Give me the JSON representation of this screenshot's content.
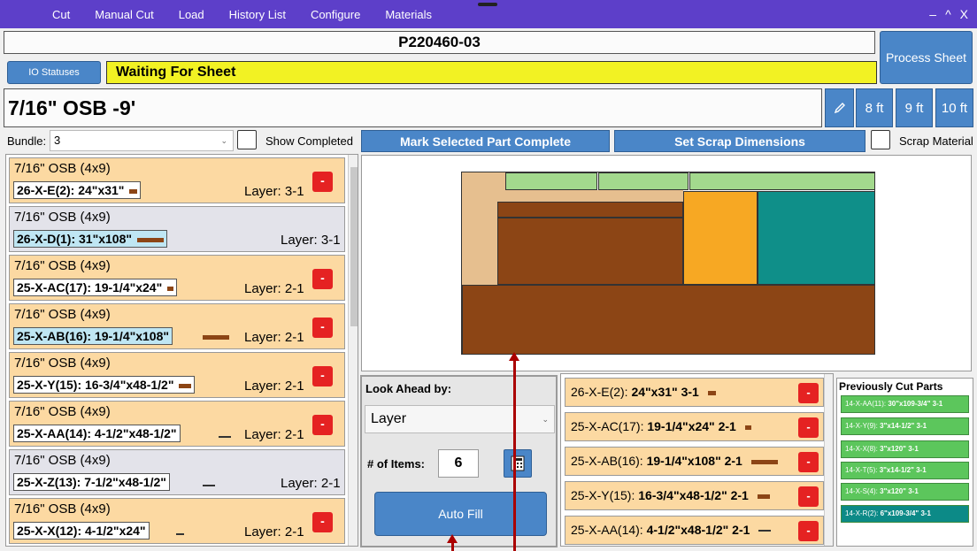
{
  "menu": {
    "items": [
      "Cut",
      "Manual Cut",
      "Load",
      "History List",
      "Configure",
      "Materials"
    ],
    "window": [
      "–",
      "^",
      "X"
    ]
  },
  "job": {
    "number": "P220460-03"
  },
  "process_sheet_label": "Process Sheet",
  "io_statuses_label": "IO Statuses",
  "status_text": "Waiting For Sheet",
  "material_name": "7/16\" OSB -9'",
  "sizes": [
    "8 ft",
    "9 ft",
    "10 ft"
  ],
  "bundle": {
    "label": "Bundle:",
    "value": "3"
  },
  "show_completed_label": "Show Completed",
  "mark_complete_label": "Mark Selected Part Complete",
  "set_scrap_label": "Set Scrap Dimensions",
  "scrap_material_label": "Scrap Material",
  "parts": [
    {
      "material": "7/16\" OSB  (4x9)",
      "part": "26-X-E(2): 24\"x31\"",
      "layer": "Layer: 3-1",
      "style": "orange",
      "remove": "-",
      "selected": false
    },
    {
      "material": "7/16\" OSB  (4x9)",
      "part": "26-X-D(1): 31\"x108\"",
      "layer": "Layer: 3-1",
      "style": "gray",
      "remove": "",
      "selected": true
    },
    {
      "material": "7/16\" OSB  (4x9)",
      "part": "25-X-AC(17): 19-1/4\"x24\"",
      "layer": "Layer: 2-1",
      "style": "orange",
      "remove": "-",
      "selected": false
    },
    {
      "material": "7/16\" OSB  (4x9)",
      "part": "25-X-AB(16): 19-1/4\"x108\"",
      "layer": "Layer: 2-1",
      "style": "orange",
      "remove": "-",
      "selected": true
    },
    {
      "material": "7/16\" OSB  (4x9)",
      "part": "25-X-Y(15): 16-3/4\"x48-1/2\"",
      "layer": "Layer: 2-1",
      "style": "orange",
      "remove": "-",
      "selected": false
    },
    {
      "material": "7/16\" OSB  (4x9)",
      "part": "25-X-AA(14): 4-1/2\"x48-1/2\"",
      "layer": "Layer: 2-1",
      "style": "orange",
      "remove": "-",
      "selected": false
    },
    {
      "material": "7/16\" OSB  (4x9)",
      "part": "25-X-Z(13): 7-1/2\"x48-1/2\"",
      "layer": "Layer: 2-1",
      "style": "gray",
      "remove": "",
      "selected": false
    },
    {
      "material": "7/16\" OSB  (4x9)",
      "part": "25-X-X(12): 4-1/2\"x24\"",
      "layer": "Layer: 2-1",
      "style": "orange",
      "remove": "-",
      "selected": false
    }
  ],
  "lookahead": {
    "label": "Look Ahead by:",
    "value": "Layer",
    "items_label": "# of Items:",
    "items_value": "6",
    "auto_fill": "Auto Fill"
  },
  "queue": [
    {
      "id": "26-X-E(2):",
      "dims": "24\"x31\"",
      "layer": "3-1",
      "remove": "-"
    },
    {
      "id": "25-X-AC(17):",
      "dims": "19-1/4\"x24\"",
      "layer": "2-1",
      "remove": "-"
    },
    {
      "id": "25-X-AB(16):",
      "dims": "19-1/4\"x108\"",
      "layer": "2-1",
      "remove": "-"
    },
    {
      "id": "25-X-Y(15):",
      "dims": "16-3/4\"x48-1/2\"",
      "layer": "2-1",
      "remove": "-"
    },
    {
      "id": "25-X-AA(14):",
      "dims": "4-1/2\"x48-1/2\"",
      "layer": "2-1",
      "remove": "-"
    }
  ],
  "previous": {
    "title": "Previously Cut Parts",
    "items": [
      {
        "id": "14-X-AA(11):",
        "dims": "30\"x109-3/4\"",
        "layer": "3-1"
      },
      {
        "id": "14-X-Y(9):",
        "dims": "3\"x14-1/2\"",
        "layer": "3-1"
      },
      {
        "id": "14-X-X(8):",
        "dims": "3\"x120\"",
        "layer": "3-1"
      },
      {
        "id": "14-X-T(5):",
        "dims": "3\"x14-1/2\"",
        "layer": "3-1"
      },
      {
        "id": "14-X-S(4):",
        "dims": "3\"x120\"",
        "layer": "3-1"
      },
      {
        "id": "14-X-R(2):",
        "dims": "6\"x109-3/4\"",
        "layer": "3-1"
      }
    ]
  },
  "colors": {
    "menubar": "#5d3fc9",
    "button": "#4a86c8",
    "status": "#f2f223",
    "card": "#fcd9a2",
    "remove": "#e52222",
    "part_brown": "#8c4515",
    "part_green": "#a3d98d",
    "part_orange": "#f7a823",
    "part_teal": "#0f8f89",
    "part_tan": "#e6bf8f",
    "prev_green": "#5cc65c",
    "prev_teal": "#0c8a87"
  }
}
